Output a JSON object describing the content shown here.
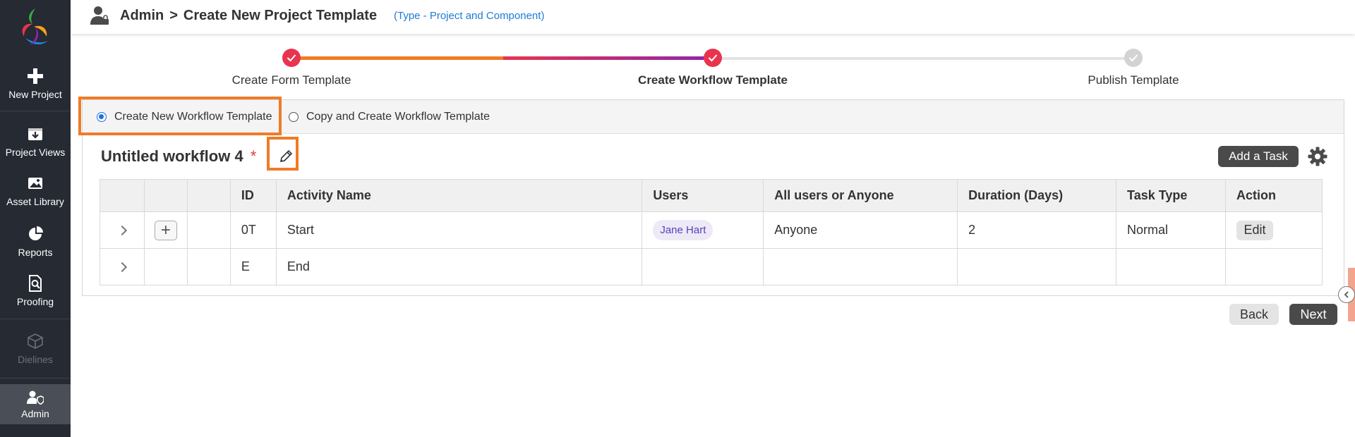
{
  "sidebar": {
    "items": [
      {
        "label": "New Project",
        "icon": "plus-icon"
      },
      {
        "label": "Project Views",
        "icon": "download-box-icon"
      },
      {
        "label": "Asset Library",
        "icon": "image-icon"
      },
      {
        "label": "Reports",
        "icon": "pie-chart-icon"
      },
      {
        "label": "Proofing",
        "icon": "document-search-icon"
      },
      {
        "label": "Dielines",
        "icon": "box-icon",
        "disabled": true
      },
      {
        "label": "Admin",
        "icon": "user-shield-icon",
        "active": true
      }
    ]
  },
  "header": {
    "section": "Admin",
    "separator": ">",
    "title": "Create New Project Template",
    "type_note": "(Type - Project and Component)"
  },
  "stepper": {
    "steps": [
      {
        "label": "Create Form Template",
        "status": "done"
      },
      {
        "label": "Create Workflow Template",
        "status": "current"
      },
      {
        "label": "Publish Template",
        "status": "pending"
      }
    ]
  },
  "mode_options": {
    "create_new": "Create New Workflow Template",
    "copy_create": "Copy and Create Workflow Template",
    "selected": "create_new"
  },
  "workflow": {
    "name": "Untitled workflow 4",
    "required_mark": "*",
    "add_task_label": "Add a Task"
  },
  "table": {
    "columns": [
      "",
      "",
      "",
      "ID",
      "Activity Name",
      "Users",
      "All users or Anyone",
      "Duration (Days)",
      "Task Type",
      "Action"
    ],
    "rows": [
      {
        "id": "0T",
        "activity": "Start",
        "user": "Jane Hart",
        "all_or_anyone": "Anyone",
        "duration": "2",
        "task_type": "Normal",
        "action": "Edit"
      },
      {
        "id": "E",
        "activity": "End",
        "user": "",
        "all_or_anyone": "",
        "duration": "",
        "task_type": "",
        "action": ""
      }
    ]
  },
  "footer": {
    "back_label": "Back",
    "next_label": "Next"
  },
  "colors": {
    "sidebar_bg": "#252a33",
    "accent_orange": "#f07b27",
    "step_done": "#e8344e",
    "link_blue": "#1e7ad6"
  }
}
